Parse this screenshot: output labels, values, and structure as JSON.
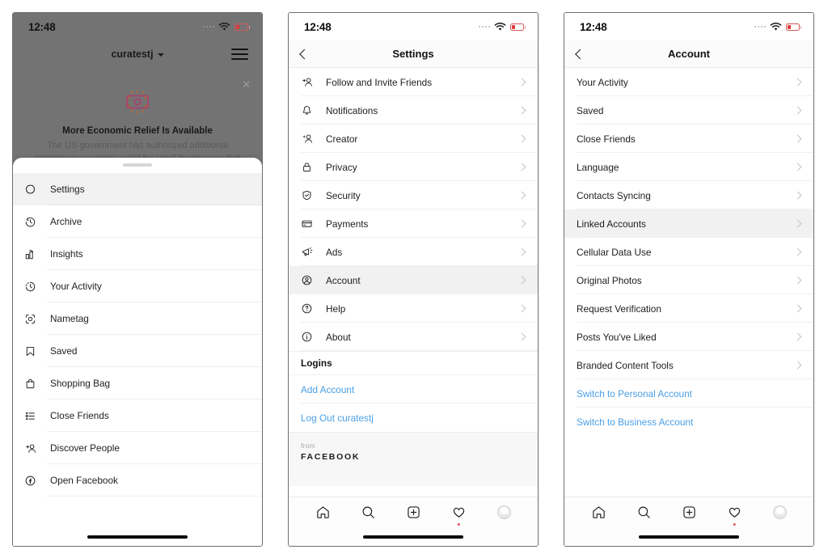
{
  "status_bar": {
    "time": "12:48",
    "battery_state": "low",
    "wifi": "wifi-icon"
  },
  "colors": {
    "link": "#4b9fe4",
    "selected_row": "#f1f1f1",
    "battery_low": "#e03b3b",
    "notification_dot": "#e0586b"
  },
  "phone1": {
    "header": {
      "username": "curatestj",
      "menu_icon": "hamburger-icon",
      "close_icon": "close-icon"
    },
    "banner": {
      "title": "More Economic Relief Is Available",
      "body": "The US government has authorized additional emergency economic relief for small businesses that qualify for the Paycheck Protection Program."
    },
    "sheet": {
      "items": [
        {
          "label": "Settings",
          "icon": "gear-icon",
          "selected": true
        },
        {
          "label": "Archive",
          "icon": "archive-clock-icon",
          "selected": false
        },
        {
          "label": "Insights",
          "icon": "insights-bar-chart-icon",
          "selected": false
        },
        {
          "label": "Your Activity",
          "icon": "activity-clock-icon",
          "selected": false
        },
        {
          "label": "Nametag",
          "icon": "nametag-scan-icon",
          "selected": false
        },
        {
          "label": "Saved",
          "icon": "bookmark-icon",
          "selected": false
        },
        {
          "label": "Shopping Bag",
          "icon": "shopping-bag-icon",
          "selected": false
        },
        {
          "label": "Close Friends",
          "icon": "list-icon",
          "selected": false
        },
        {
          "label": "Discover People",
          "icon": "add-person-icon",
          "selected": false
        },
        {
          "label": "Open Facebook",
          "icon": "facebook-icon",
          "selected": false
        }
      ]
    }
  },
  "phone2": {
    "nav": {
      "title": "Settings",
      "back_icon": "back-chevron-icon"
    },
    "items": [
      {
        "label": "Follow and Invite Friends",
        "icon": "add-person-icon",
        "selected": false
      },
      {
        "label": "Notifications",
        "icon": "bell-icon",
        "selected": false
      },
      {
        "label": "Creator",
        "icon": "creator-person-icon",
        "selected": false
      },
      {
        "label": "Privacy",
        "icon": "lock-icon",
        "selected": false
      },
      {
        "label": "Security",
        "icon": "shield-check-icon",
        "selected": false
      },
      {
        "label": "Payments",
        "icon": "credit-card-icon",
        "selected": false
      },
      {
        "label": "Ads",
        "icon": "megaphone-icon",
        "selected": false
      },
      {
        "label": "Account",
        "icon": "account-circle-icon",
        "selected": true
      },
      {
        "label": "Help",
        "icon": "question-circle-icon",
        "selected": false
      },
      {
        "label": "About",
        "icon": "info-circle-icon",
        "selected": false
      }
    ],
    "logins_header": "Logins",
    "links": [
      {
        "label": "Add Account"
      },
      {
        "label": "Log Out curatestj"
      }
    ],
    "footer": {
      "from": "from",
      "brand": "FACEBOOK"
    }
  },
  "phone3": {
    "nav": {
      "title": "Account",
      "back_icon": "back-chevron-icon"
    },
    "items": [
      {
        "label": "Your Activity",
        "selected": false
      },
      {
        "label": "Saved",
        "selected": false
      },
      {
        "label": "Close Friends",
        "selected": false
      },
      {
        "label": "Language",
        "selected": false
      },
      {
        "label": "Contacts Syncing",
        "selected": false
      },
      {
        "label": "Linked Accounts",
        "selected": true
      },
      {
        "label": "Cellular Data Use",
        "selected": false
      },
      {
        "label": "Original Photos",
        "selected": false
      },
      {
        "label": "Request Verification",
        "selected": false
      },
      {
        "label": "Posts You've Liked",
        "selected": false
      },
      {
        "label": "Branded Content Tools",
        "selected": false
      }
    ],
    "links": [
      {
        "label": "Switch to Personal Account"
      },
      {
        "label": "Switch to Business Account"
      }
    ]
  },
  "tabbar": {
    "tabs": [
      {
        "name": "home",
        "icon": "home-icon",
        "badge": false
      },
      {
        "name": "search",
        "icon": "search-icon",
        "badge": false
      },
      {
        "name": "create",
        "icon": "plus-square-icon",
        "badge": false
      },
      {
        "name": "activity",
        "icon": "heart-icon",
        "badge": true
      },
      {
        "name": "profile",
        "icon": "avatar-icon",
        "badge": false
      }
    ]
  }
}
